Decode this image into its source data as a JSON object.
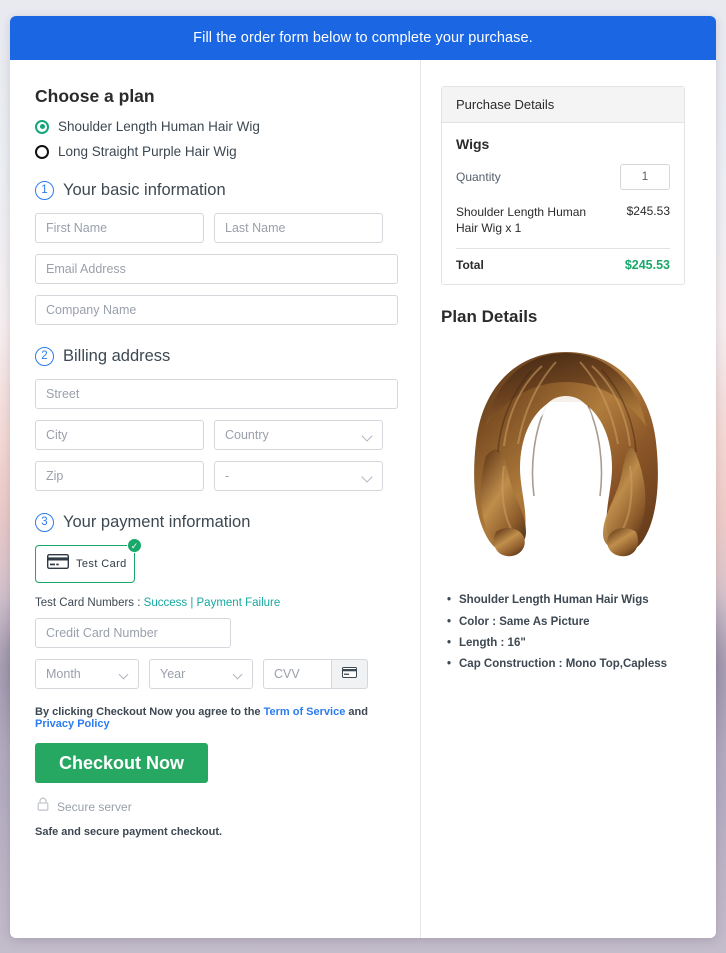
{
  "banner": {
    "text": "Fill the order form below to complete your purchase."
  },
  "plans": {
    "heading": "Choose a plan",
    "options": [
      {
        "label": "Shoulder Length Human Hair Wig",
        "selected": true
      },
      {
        "label": "Long Straight Purple Hair Wig",
        "selected": false
      }
    ]
  },
  "steps": {
    "basic": {
      "number": "1",
      "title": "Your basic information"
    },
    "billing": {
      "number": "2",
      "title": "Billing address"
    },
    "payment": {
      "number": "3",
      "title": "Your payment information"
    }
  },
  "fields": {
    "first_name": {
      "placeholder": "First Name",
      "value": ""
    },
    "last_name": {
      "placeholder": "Last Name",
      "value": ""
    },
    "email": {
      "placeholder": "Email Address",
      "value": ""
    },
    "company": {
      "placeholder": "Company Name",
      "value": ""
    },
    "street": {
      "placeholder": "Street",
      "value": ""
    },
    "city": {
      "placeholder": "City",
      "value": ""
    },
    "country": {
      "placeholder": "Country",
      "value": ""
    },
    "zip": {
      "placeholder": "Zip",
      "value": ""
    },
    "state": {
      "placeholder": "-",
      "value": "-"
    },
    "card_number": {
      "placeholder": "Credit Card Number",
      "value": ""
    },
    "month": {
      "placeholder": "Month",
      "value": ""
    },
    "year": {
      "placeholder": "Year",
      "value": ""
    },
    "cvv": {
      "placeholder": "CVV",
      "value": ""
    }
  },
  "payment": {
    "test_card_label": "Test  Card",
    "test_card_selected": true,
    "check_glyph": "✓",
    "note_prefix": "Test Card Numbers : ",
    "note_success": "Success",
    "note_separator": " | ",
    "note_failure": "Payment Failure"
  },
  "agreement": {
    "prefix": "By clicking Checkout Now you agree to the ",
    "terms": "Term of Service",
    "middle": " and ",
    "privacy": "Privacy Policy"
  },
  "actions": {
    "checkout_label": "Checkout Now",
    "secure_server": "Secure server",
    "safe_note": "Safe and secure payment checkout."
  },
  "purchase_details": {
    "header": "Purchase Details",
    "category": "Wigs",
    "quantity_label": "Quantity",
    "quantity_value": "1",
    "line_item_name": "Shoulder Length Human Hair Wig x 1",
    "line_item_price": "$245.53",
    "total_label": "Total",
    "total_value": "$245.53"
  },
  "plan_details": {
    "heading": "Plan Details",
    "image_alt": "shoulder-length-auburn-wavy-wig",
    "bullets": [
      "Shoulder Length Human Hair Wigs",
      "Color : Same As Picture",
      "Length : 16\"",
      "Cap Construction : Mono Top,Capless"
    ]
  },
  "colors": {
    "banner_blue": "#1a66e3",
    "accent_green": "#27a862",
    "check_green": "#17a86a",
    "link_teal": "#17a8a0",
    "step_blue": "#2b7cf0",
    "total_green": "#17a86a"
  }
}
